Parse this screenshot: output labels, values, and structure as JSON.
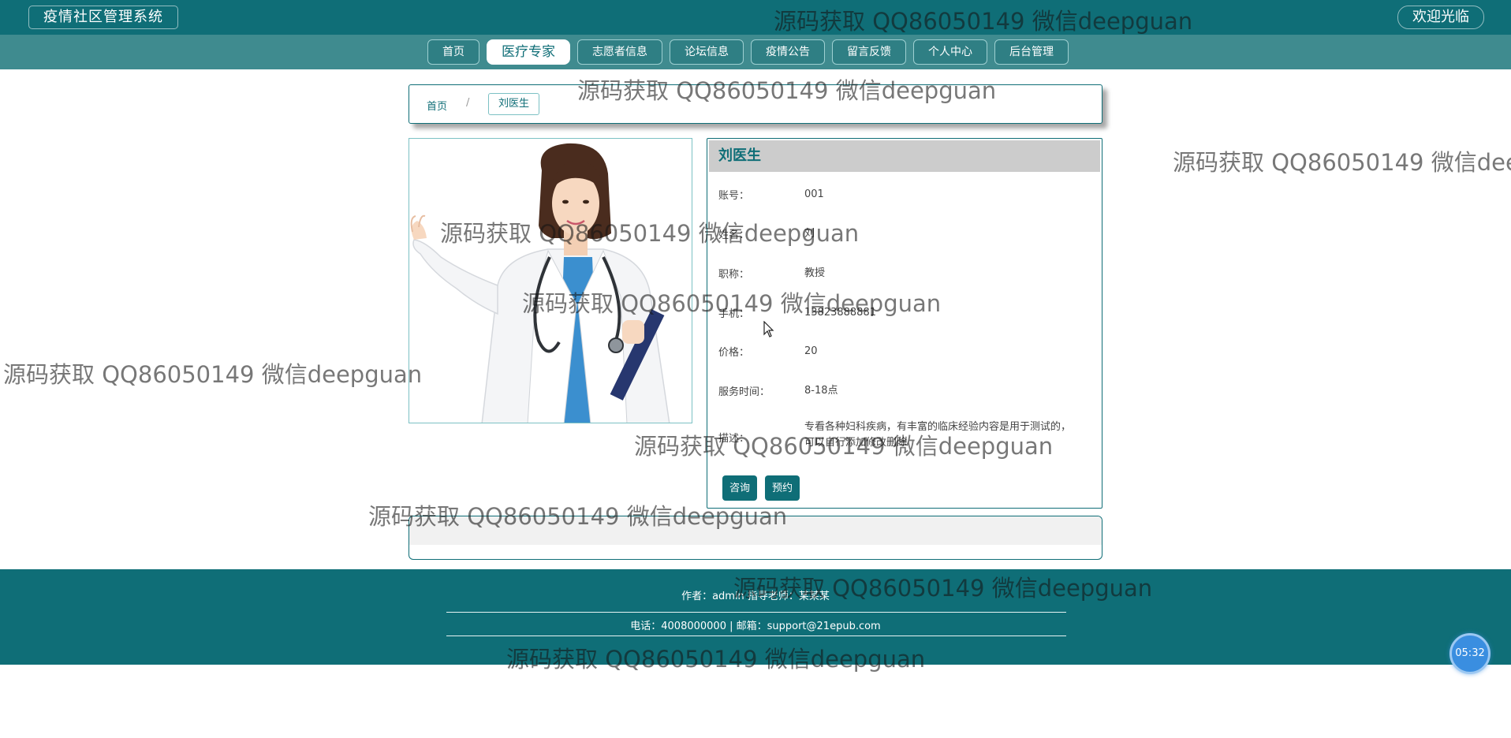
{
  "header": {
    "app_title": "疫情社区管理系统",
    "welcome": "欢迎光临"
  },
  "nav": {
    "items": [
      "首页",
      "医疗专家",
      "志愿者信息",
      "论坛信息",
      "疫情公告",
      "留言反馈",
      "个人中心",
      "后台管理"
    ],
    "active": "医疗专家"
  },
  "breadcrumb": {
    "home": "首页",
    "separator": "/",
    "current": "刘医生"
  },
  "detail": {
    "title": "刘医生",
    "fields": [
      {
        "label": "账号：",
        "value": "001"
      },
      {
        "label": "姓名：",
        "value": "刘"
      },
      {
        "label": "职称：",
        "value": "教授"
      },
      {
        "label": "手机：",
        "value": "13823888881"
      },
      {
        "label": "价格：",
        "value": "20"
      },
      {
        "label": "服务时间：",
        "value": "8-18点"
      },
      {
        "label": "描述：",
        "value": "专看各种妇科疾病，有丰富的临床经验内容是用于测试的，可以自行添加修改删除"
      }
    ],
    "buttons": {
      "consult": "咨询",
      "reserve": "预约"
    }
  },
  "footer": {
    "line1": "作者：admin 指导老师：某某某",
    "line2": "电话：4008000000 | 邮箱：support@21epub.com"
  },
  "timer": "05:32",
  "watermark": "源码获取 QQ86050149 微信deepguan",
  "colors": {
    "primary": "#0f6e77",
    "nav_bg": "#3f8b8f",
    "title_bar": "#cccccc",
    "timer": "#3a8ee0"
  }
}
